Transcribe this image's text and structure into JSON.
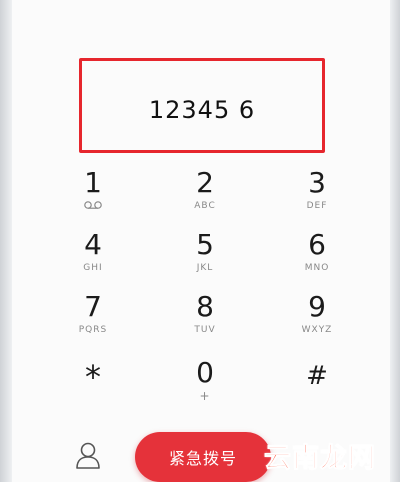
{
  "dialer": {
    "number": "12345 6",
    "keys": [
      {
        "digit": "1",
        "sub": ""
      },
      {
        "digit": "2",
        "sub": "ABC"
      },
      {
        "digit": "3",
        "sub": "DEF"
      },
      {
        "digit": "4",
        "sub": "GHI"
      },
      {
        "digit": "5",
        "sub": "JKL"
      },
      {
        "digit": "6",
        "sub": "MNO"
      },
      {
        "digit": "7",
        "sub": "PQRS"
      },
      {
        "digit": "8",
        "sub": "TUV"
      },
      {
        "digit": "9",
        "sub": "WXYZ"
      },
      {
        "digit": "*",
        "sub": ""
      },
      {
        "digit": "0",
        "sub": "+"
      },
      {
        "digit": "#",
        "sub": ""
      }
    ],
    "emergency_label": "紧急拨号"
  },
  "icons": {
    "voicemail": "voicemail-icon",
    "contacts": "contacts-icon"
  },
  "watermark": "云南龙网",
  "colors": {
    "highlight_border": "#e6262d",
    "emergency_button": "#e5323a",
    "watermark": "#ff3c1e"
  }
}
